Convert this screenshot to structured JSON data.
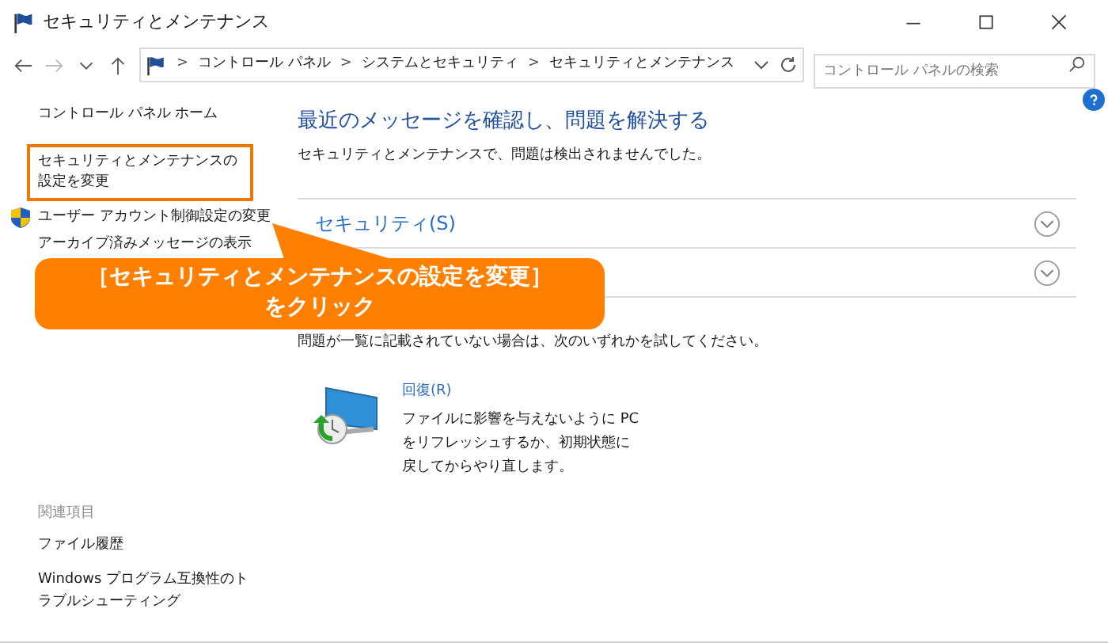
{
  "window": {
    "title": "セキュリティとメンテナンス"
  },
  "address_bar": {
    "breadcrumbs": [
      "コントロール パネル",
      "システムとセキュリティ",
      "セキュリティとメンテナンス"
    ],
    "separator": ">"
  },
  "search": {
    "placeholder": "コントロール パネルの検索"
  },
  "sidebar": {
    "items": [
      {
        "label": "コントロール パネル ホーム",
        "kind": "link",
        "highlighted": false
      },
      {
        "label": "セキュリティとメンテナンスの設定を変更",
        "kind": "link",
        "highlighted": true
      },
      {
        "label": "ユーザー アカウント制御設定の変更",
        "kind": "shield",
        "highlighted": false
      },
      {
        "label": "アーカイブ済みメッセージの表示",
        "kind": "link",
        "highlighted": false
      }
    ],
    "related_heading": "関連項目",
    "related": [
      "ファイル履歴",
      "Windows プログラム互換性のトラブルシューティング"
    ]
  },
  "main": {
    "heading": "最近のメッセージを確認し、問題を解決する",
    "status": "セキュリティとメンテナンスで、問題は検出されませんでした。",
    "sections": [
      {
        "title": "セキュリティ(S)",
        "expanded": false
      },
      {
        "expanded": false
      }
    ],
    "hint": "問題が一覧に記載されていない場合は、次のいずれかを試してください。",
    "recovery": {
      "title": "回復(R)",
      "description": "ファイルに影響を与えないように PC をリフレッシュするか、初期状態に戻してからやり直します。"
    }
  },
  "callout": {
    "lines": [
      "［セキュリティとメンテナンスの設定を変更］",
      "をクリック"
    ]
  }
}
